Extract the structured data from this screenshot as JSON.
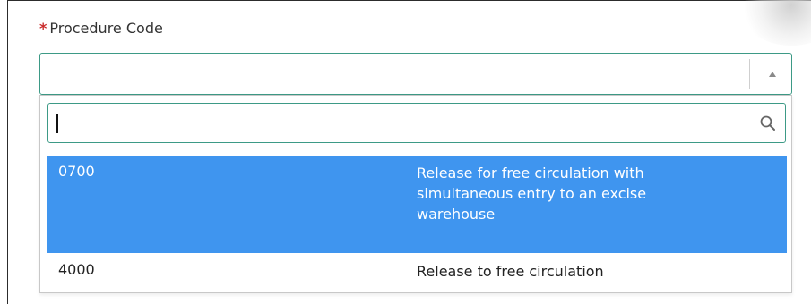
{
  "field": {
    "label": "Procedure Code",
    "required_marker": "*",
    "selected_value": ""
  },
  "search": {
    "value": "",
    "icon": "search-icon"
  },
  "options": [
    {
      "code": "0700",
      "description": "Release for free circulation with simultaneous entry to an excise warehouse",
      "highlighted": true
    },
    {
      "code": "4000",
      "description": "Release to free circulation",
      "highlighted": false
    }
  ],
  "colors": {
    "accent_border": "#3d9a86",
    "highlight": "#3f95ef",
    "required": "#c92a2a"
  }
}
